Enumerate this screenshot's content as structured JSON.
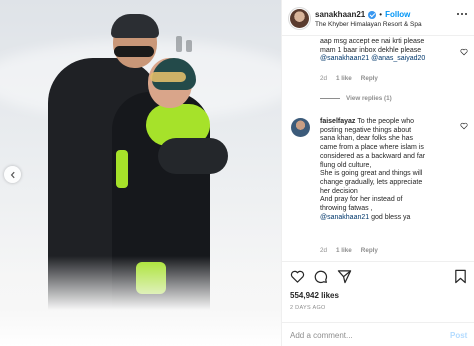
{
  "header": {
    "username": "sanakhaan21",
    "separator": "•",
    "follow_label": "Follow",
    "location": "The Khyber Himalayan Resort & Spa"
  },
  "comment1": {
    "line1": "aap msg accept ee nai krti please",
    "line2": "mam 1 baar inbox dekhle please",
    "mention1": "@sanakhaan21",
    "mention2": "@anas_saiyad20",
    "time": "2d",
    "likes": "1 like",
    "reply": "Reply",
    "view_replies": "View replies (1)"
  },
  "comment2": {
    "username": "faiselfayaz",
    "lines": [
      "To the people who",
      "posting negative things about",
      "sana khan, dear folks she has",
      "came from a place where islam is",
      "considered as a backward and far",
      "flung old culture,",
      "She is going great and things will",
      "change gradually, lets appreciate",
      "her decision",
      "And pray for her instead of",
      "throwing fatwas ,"
    ],
    "mention": "@sanakhaan21",
    "tail": "god bless ya",
    "time": "2d",
    "likes": "1 like",
    "reply": "Reply"
  },
  "actions": {
    "likes": "554,942 likes",
    "ago": "2 DAYS AGO"
  },
  "add_comment": {
    "placeholder": "Add a comment...",
    "post_label": "Post"
  },
  "colors": {
    "accent": "#0095f6",
    "verified": "#3897f0",
    "post_disabled": "#b3dbff",
    "jacket_lime": "#a6e22a"
  },
  "icons": [
    "verified-badge-icon",
    "more-options-icon",
    "heart-icon",
    "comment-icon",
    "share-icon",
    "bookmark-icon",
    "chevron-left-icon"
  ]
}
